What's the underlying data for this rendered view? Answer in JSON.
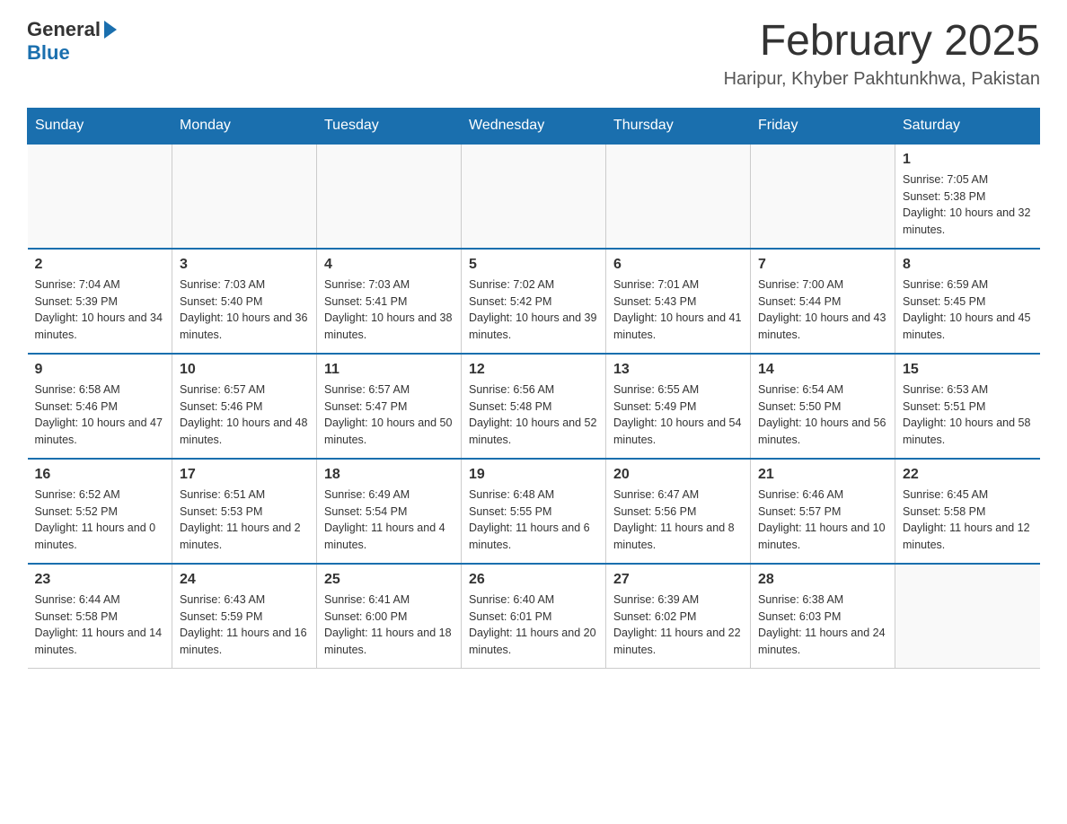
{
  "logo": {
    "text1": "General",
    "text2": "Blue"
  },
  "title": "February 2025",
  "location": "Haripur, Khyber Pakhtunkhwa, Pakistan",
  "days_of_week": [
    "Sunday",
    "Monday",
    "Tuesday",
    "Wednesday",
    "Thursday",
    "Friday",
    "Saturday"
  ],
  "weeks": [
    [
      {
        "day": "",
        "info": ""
      },
      {
        "day": "",
        "info": ""
      },
      {
        "day": "",
        "info": ""
      },
      {
        "day": "",
        "info": ""
      },
      {
        "day": "",
        "info": ""
      },
      {
        "day": "",
        "info": ""
      },
      {
        "day": "1",
        "info": "Sunrise: 7:05 AM\nSunset: 5:38 PM\nDaylight: 10 hours and 32 minutes."
      }
    ],
    [
      {
        "day": "2",
        "info": "Sunrise: 7:04 AM\nSunset: 5:39 PM\nDaylight: 10 hours and 34 minutes."
      },
      {
        "day": "3",
        "info": "Sunrise: 7:03 AM\nSunset: 5:40 PM\nDaylight: 10 hours and 36 minutes."
      },
      {
        "day": "4",
        "info": "Sunrise: 7:03 AM\nSunset: 5:41 PM\nDaylight: 10 hours and 38 minutes."
      },
      {
        "day": "5",
        "info": "Sunrise: 7:02 AM\nSunset: 5:42 PM\nDaylight: 10 hours and 39 minutes."
      },
      {
        "day": "6",
        "info": "Sunrise: 7:01 AM\nSunset: 5:43 PM\nDaylight: 10 hours and 41 minutes."
      },
      {
        "day": "7",
        "info": "Sunrise: 7:00 AM\nSunset: 5:44 PM\nDaylight: 10 hours and 43 minutes."
      },
      {
        "day": "8",
        "info": "Sunrise: 6:59 AM\nSunset: 5:45 PM\nDaylight: 10 hours and 45 minutes."
      }
    ],
    [
      {
        "day": "9",
        "info": "Sunrise: 6:58 AM\nSunset: 5:46 PM\nDaylight: 10 hours and 47 minutes."
      },
      {
        "day": "10",
        "info": "Sunrise: 6:57 AM\nSunset: 5:46 PM\nDaylight: 10 hours and 48 minutes."
      },
      {
        "day": "11",
        "info": "Sunrise: 6:57 AM\nSunset: 5:47 PM\nDaylight: 10 hours and 50 minutes."
      },
      {
        "day": "12",
        "info": "Sunrise: 6:56 AM\nSunset: 5:48 PM\nDaylight: 10 hours and 52 minutes."
      },
      {
        "day": "13",
        "info": "Sunrise: 6:55 AM\nSunset: 5:49 PM\nDaylight: 10 hours and 54 minutes."
      },
      {
        "day": "14",
        "info": "Sunrise: 6:54 AM\nSunset: 5:50 PM\nDaylight: 10 hours and 56 minutes."
      },
      {
        "day": "15",
        "info": "Sunrise: 6:53 AM\nSunset: 5:51 PM\nDaylight: 10 hours and 58 minutes."
      }
    ],
    [
      {
        "day": "16",
        "info": "Sunrise: 6:52 AM\nSunset: 5:52 PM\nDaylight: 11 hours and 0 minutes."
      },
      {
        "day": "17",
        "info": "Sunrise: 6:51 AM\nSunset: 5:53 PM\nDaylight: 11 hours and 2 minutes."
      },
      {
        "day": "18",
        "info": "Sunrise: 6:49 AM\nSunset: 5:54 PM\nDaylight: 11 hours and 4 minutes."
      },
      {
        "day": "19",
        "info": "Sunrise: 6:48 AM\nSunset: 5:55 PM\nDaylight: 11 hours and 6 minutes."
      },
      {
        "day": "20",
        "info": "Sunrise: 6:47 AM\nSunset: 5:56 PM\nDaylight: 11 hours and 8 minutes."
      },
      {
        "day": "21",
        "info": "Sunrise: 6:46 AM\nSunset: 5:57 PM\nDaylight: 11 hours and 10 minutes."
      },
      {
        "day": "22",
        "info": "Sunrise: 6:45 AM\nSunset: 5:58 PM\nDaylight: 11 hours and 12 minutes."
      }
    ],
    [
      {
        "day": "23",
        "info": "Sunrise: 6:44 AM\nSunset: 5:58 PM\nDaylight: 11 hours and 14 minutes."
      },
      {
        "day": "24",
        "info": "Sunrise: 6:43 AM\nSunset: 5:59 PM\nDaylight: 11 hours and 16 minutes."
      },
      {
        "day": "25",
        "info": "Sunrise: 6:41 AM\nSunset: 6:00 PM\nDaylight: 11 hours and 18 minutes."
      },
      {
        "day": "26",
        "info": "Sunrise: 6:40 AM\nSunset: 6:01 PM\nDaylight: 11 hours and 20 minutes."
      },
      {
        "day": "27",
        "info": "Sunrise: 6:39 AM\nSunset: 6:02 PM\nDaylight: 11 hours and 22 minutes."
      },
      {
        "day": "28",
        "info": "Sunrise: 6:38 AM\nSunset: 6:03 PM\nDaylight: 11 hours and 24 minutes."
      },
      {
        "day": "",
        "info": ""
      }
    ]
  ]
}
